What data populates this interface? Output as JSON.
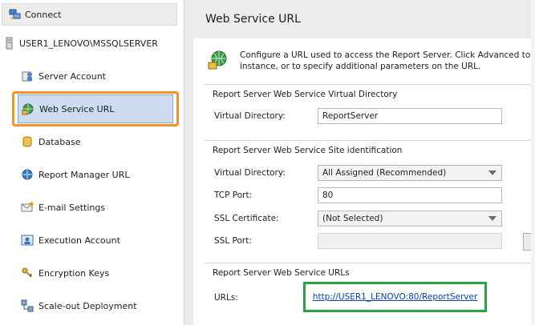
{
  "nav": {
    "connect_label": "Connect",
    "server_label": "USER1_LENOVO\\MSSQLSERVER",
    "items": [
      {
        "label": "Server Account",
        "icon": "server-account-icon"
      },
      {
        "label": "Web Service URL",
        "icon": "web-service-icon"
      },
      {
        "label": "Database",
        "icon": "database-icon"
      },
      {
        "label": "Report Manager URL",
        "icon": "report-manager-icon"
      },
      {
        "label": "E-mail Settings",
        "icon": "email-icon"
      },
      {
        "label": "Execution Account",
        "icon": "execution-account-icon"
      },
      {
        "label": "Encryption Keys",
        "icon": "keys-icon"
      },
      {
        "label": "Scale-out Deployment",
        "icon": "scale-out-icon"
      }
    ],
    "selected_index": 1
  },
  "pane": {
    "title": "Web Service URL",
    "intro": "Configure a URL used to access the Report Server. Click Advanced to def... instance, or to specify additional parameters on the URL.",
    "intro_line1": "Configure a URL used to access the Report Server. Click Advanced to def...",
    "intro_line2": "instance, or to specify additional parameters on the URL.",
    "vdir_group": {
      "title": "Report Server Web Service Virtual Directory",
      "vdir_label": "Virtual Directory:",
      "vdir_value": "ReportServer"
    },
    "site_group": {
      "title": "Report Server Web Service Site identification",
      "vdir_label": "Virtual Directory:",
      "vdir_value": "All Assigned (Recommended)",
      "tcp_label": "TCP Port:",
      "tcp_value": "80",
      "ssl_cert_label": "SSL Certificate:",
      "ssl_cert_value": "(Not Selected)",
      "ssl_port_label": "SSL Port:",
      "ssl_port_value": ""
    },
    "urls_group": {
      "title": "Report Server Web Service URLs",
      "urls_label": "URLs:",
      "url": "http://USER1_LENOVO:80/ReportServer"
    }
  },
  "colors": {
    "selection_highlight": "#f39421",
    "url_highlight": "#2ba244",
    "link": "#0645ad"
  }
}
